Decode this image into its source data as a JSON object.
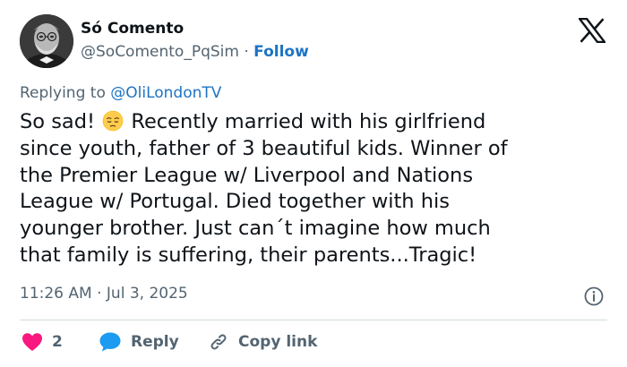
{
  "author": {
    "display_name": "Só Comento",
    "handle": "@SoComento_PqSim",
    "separator": "·",
    "follow_label": "Follow"
  },
  "reply_context": {
    "prefix": "Replying to ",
    "mention": "@OliLondonTV"
  },
  "tweet": {
    "lines": [
      "So sad!",
      "Recently married with his girlfriend",
      "since youth, father of 3 beautiful kids. Winner of",
      "the Premier League w/ Liverpool and Nations",
      "League w/ Portugal. Died together with his",
      "younger brother. Just can´t imagine how much",
      "that family is suffering, their parents...Tragic!"
    ],
    "emoji": "pensive-face"
  },
  "meta": {
    "time": "11:26 AM",
    "separator": "·",
    "date": "Jul 3, 2025"
  },
  "actions": {
    "like_count": "2",
    "reply_label": "Reply",
    "copy_link_label": "Copy link"
  },
  "colors": {
    "text": "#0f1419",
    "muted": "#536471",
    "link": "#1d74c4",
    "like": "#f91880",
    "reply": "#1d9bf0",
    "divider": "#cfd9de"
  },
  "icons": {
    "brand": "x-logo-icon",
    "info": "info-icon",
    "like": "heart-icon",
    "reply": "speech-bubble-icon",
    "copy": "link-icon"
  }
}
